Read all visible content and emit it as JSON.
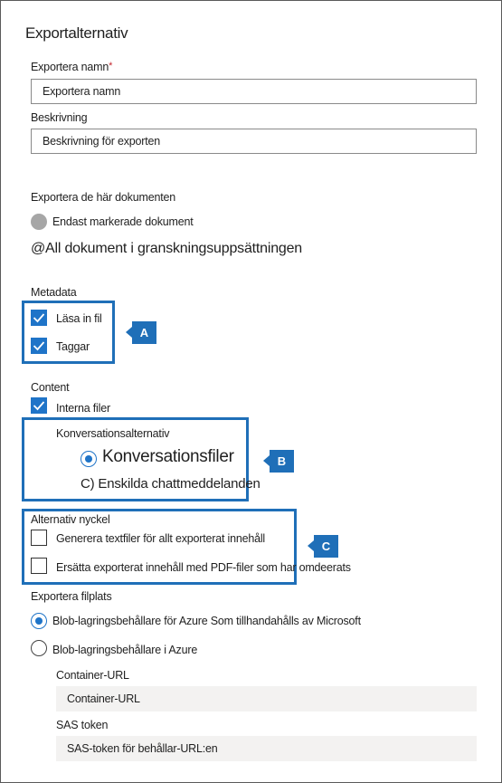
{
  "panel": {
    "title": "Exportalternativ",
    "export_name": {
      "label": "Exportera namn",
      "required_mark": "*",
      "value": "Exportera namn"
    },
    "description": {
      "label": "Beskrivning",
      "value": "Beskrivning för exporten"
    },
    "export_docs": {
      "label": "Exportera de här dokumenten",
      "option_selected_docs": "Endast markerade dokument",
      "option_all_docs": "@All dokument i granskningsuppsättningen"
    },
    "metadata": {
      "label": "Metadata",
      "items": [
        {
          "label": "Läsa in fil",
          "checked": true
        },
        {
          "label": "Taggar",
          "checked": true
        }
      ]
    },
    "content": {
      "label": "Content",
      "native_files": {
        "label": "Interna filer",
        "checked": true
      },
      "conversation_options": {
        "label": "Konversationsalternativ",
        "option_conversation_files": "Konversationsfiler",
        "option_individual_messages": "C) Enskilda chattmeddelanden"
      }
    },
    "alt_key": {
      "label": "Alternativ nyckel",
      "items": [
        {
          "label": "Generera textfiler för allt exporterat innehåll",
          "checked": false
        },
        {
          "label": "Ersätta exporterat innehåll med PDF-filer som har omdeerats",
          "checked": false
        }
      ]
    },
    "location": {
      "label": "Exportera filplats",
      "option_microsoft": "Blob-lagringsbehållare för Azure Som tillhandahålls av Microsoft",
      "option_azure": "Blob-lagringsbehållare i Azure",
      "container_url": {
        "label": "Container-URL",
        "placeholder": "Container-URL"
      },
      "sas_token": {
        "label": "SAS token",
        "placeholder": "SAS-token för behållar-URL:en"
      }
    }
  },
  "callouts": {
    "a": "A",
    "b": "B",
    "c": "C"
  },
  "colors": {
    "accent": "#1f74c8",
    "callout": "#1f6fb8"
  }
}
